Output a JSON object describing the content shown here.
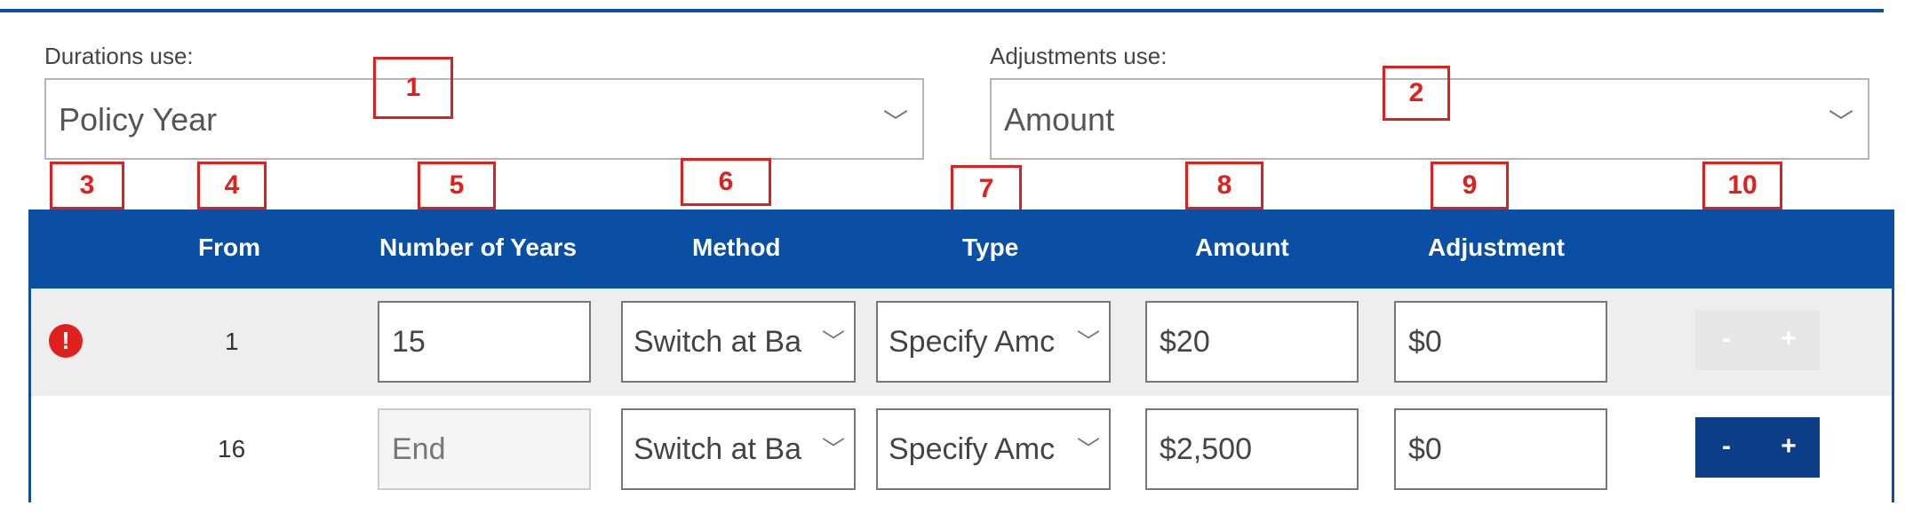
{
  "durations": {
    "label": "Durations use:",
    "value": "Policy Year"
  },
  "adjustments": {
    "label": "Adjustments use:",
    "value": "Amount"
  },
  "callouts": [
    "1",
    "2",
    "3",
    "4",
    "5",
    "6",
    "7",
    "8",
    "9",
    "10"
  ],
  "table": {
    "headers": {
      "from": "From",
      "years": "Number of Years",
      "method": "Method",
      "type": "Type",
      "amount": "Amount",
      "adjustment": "Adjustment"
    },
    "rows": [
      {
        "status_icon": "!",
        "from": "1",
        "years": "15",
        "method": "Switch at Ba",
        "type": "Specify Amc",
        "amount": "$20",
        "adjustment": "$0",
        "minus": "-",
        "plus": "+"
      },
      {
        "from": "16",
        "years": "End",
        "method": "Switch at Ba",
        "type": "Specify Amc",
        "amount": "$2,500",
        "adjustment": "$0",
        "minus": "-",
        "plus": "+"
      }
    ]
  },
  "colors": {
    "header": "#0a4fa3",
    "callout": "#e0201c",
    "button_active": "#0b3e86",
    "row_alt": "#eeeeee"
  },
  "icons": {
    "dropdown": "chevron-down-icon",
    "warning": "error-icon"
  }
}
